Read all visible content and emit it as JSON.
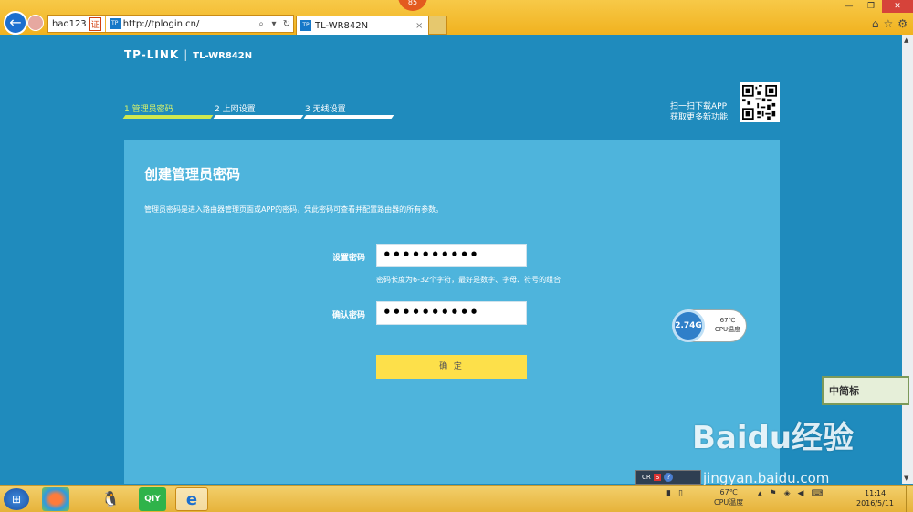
{
  "browser": {
    "address_left": "hao123",
    "address_badge": "证",
    "favicon_text": "TP",
    "url": "http://tplogin.cn/",
    "tab_title": "TL-WR842N",
    "score_badge": "85"
  },
  "router": {
    "brand": "TP-LINK",
    "model": "TL-WR842N",
    "steps": [
      {
        "label": "1 管理员密码",
        "active": true
      },
      {
        "label": "2 上网设置",
        "active": false
      },
      {
        "label": "3 无线设置",
        "active": false
      }
    ],
    "app_line1": "扫一扫下载APP",
    "app_line2": "获取更多新功能",
    "card_title": "创建管理员密码",
    "description": "管理员密码是进入路由器管理页面或APP的密码，凭此密码可查看并配置路由器的所有参数。",
    "password_label": "设置密码",
    "password_value": "••••••••••",
    "password_hint": "密码长度为6-32个字符，最好是数字、字母、符号的组合",
    "confirm_label": "确认密码",
    "confirm_value": "••••••••••",
    "submit_label": "确 定"
  },
  "overlay": {
    "cpu_speed": "2.74G",
    "cpu_temp": "67℃",
    "cpu_temp_label": "CPU温度",
    "zhongjianbiao": "中简标",
    "baidu_text": "Baidu经验",
    "jingyan_url": "jingyan.baidu.com",
    "tray_popup_cr": "CR",
    "tray_popup_s": "S"
  },
  "taskbar": {
    "temp": "67℃",
    "temp_label": "CPU温度",
    "time": "11:14",
    "date": "2016/5/11"
  }
}
